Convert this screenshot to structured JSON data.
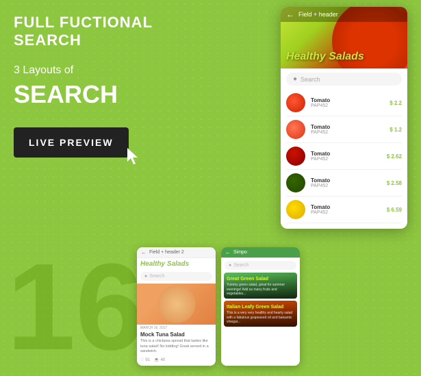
{
  "page": {
    "background_color": "#8dc63f",
    "watermark": "16"
  },
  "header": {
    "title": "FULL FUCTIONAL SEARCH"
  },
  "left": {
    "layouts_label": "3 Layouts of",
    "search_label": "SEARCH",
    "live_preview_label": "LIVE PREVIEW"
  },
  "phone_large": {
    "nav_title": "Field + header",
    "header_title": "Healthy Salads",
    "search_placeholder": "Search",
    "items": [
      {
        "name": "Tomato",
        "code": "PAP452",
        "price": "$ 2.2",
        "type": "tomato"
      },
      {
        "name": "Tomato",
        "code": "PAP452",
        "price": "$ 1.2",
        "type": "tomato2"
      },
      {
        "name": "Tomato",
        "code": "PAP452",
        "price": "$ 2.62",
        "type": "cherry"
      },
      {
        "name": "Tomato",
        "code": "PAP452",
        "price": "$ 2.58",
        "type": "avocado"
      },
      {
        "name": "Tomato",
        "code": "PAP452",
        "price": "$ 6.59",
        "type": "lemon"
      }
    ]
  },
  "phone_small1": {
    "nav_title": "Field + header 2",
    "header_title": "Healthy Salads",
    "search_placeholder": "Search",
    "card_date": "MARCH 16, 2017",
    "card_title": "Mock Tuna Salad",
    "card_desc": "This is a chickpea spread that tastes like tuna salad! No kidding! Great served in a sandwich.",
    "likes": "91",
    "comments": "40"
  },
  "phone_small2": {
    "nav_title": "Simpo",
    "search_placeholder": "Search",
    "card1_title": "Great Green Salad",
    "card1_desc": "Yummy green salad, great for summer evenings! Add as many fruits and vegetables...",
    "card2_title": "Italian Leafy Green Salad",
    "card2_desc": "This is a very very healthy and hearty salad with a fabulous grapeseed oil and balsamic vinegar..."
  }
}
